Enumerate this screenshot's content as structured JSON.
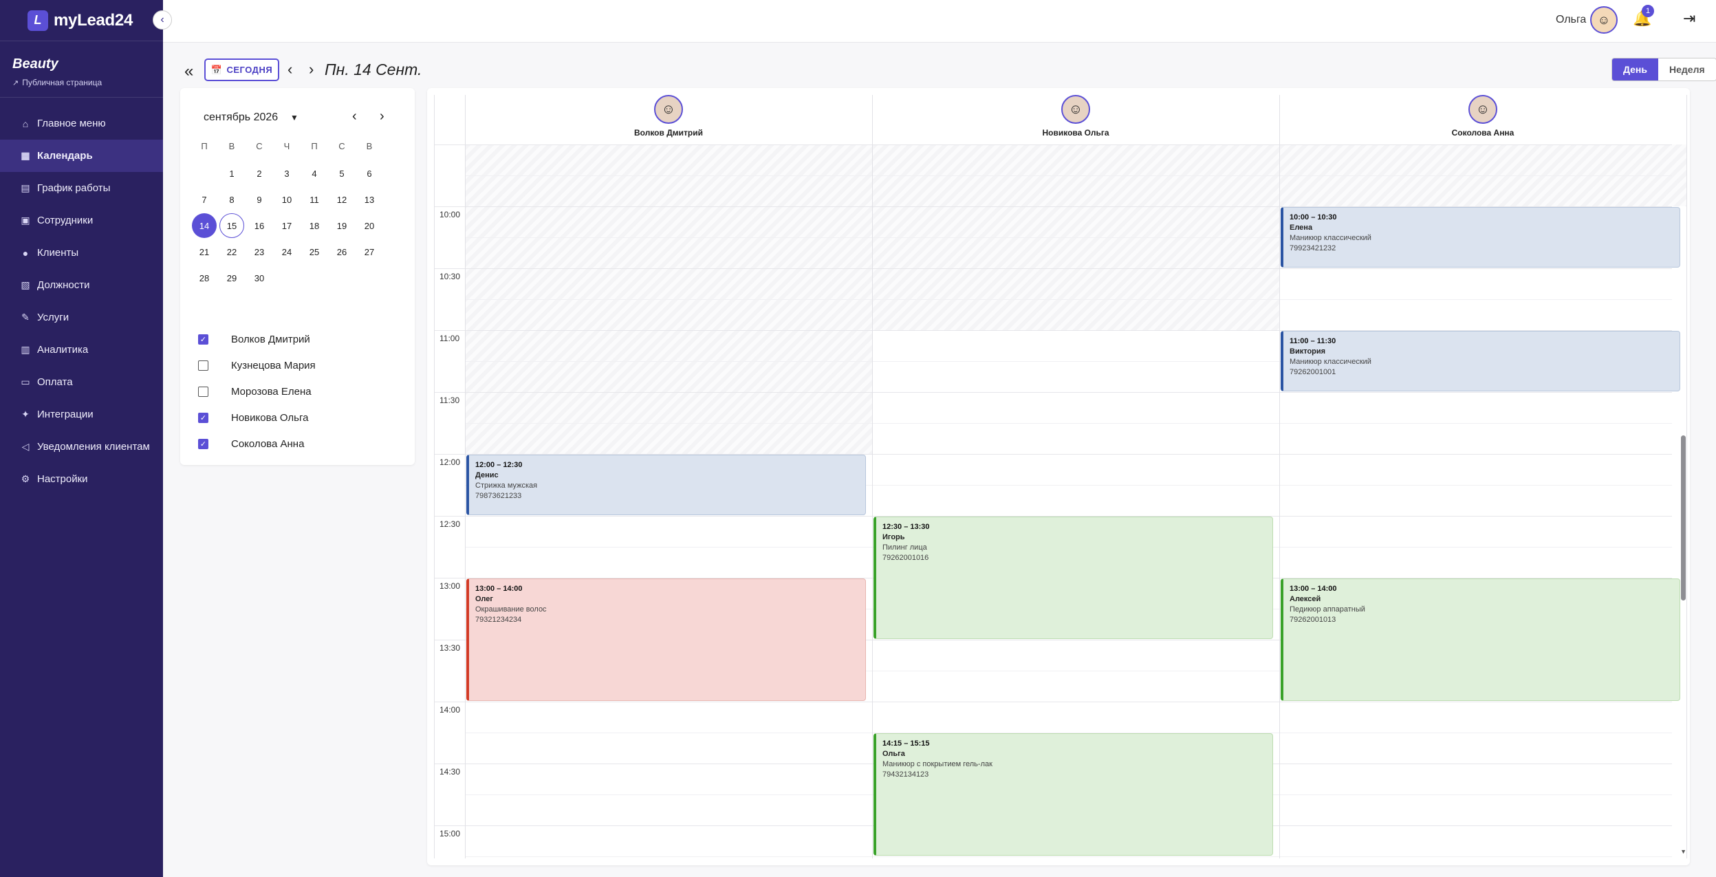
{
  "brand": {
    "logo_letter": "L",
    "name": "myLead24"
  },
  "organization": {
    "name": "Beauty",
    "public_page_label": "Публичная страница"
  },
  "menu": [
    {
      "label": "Главное меню",
      "icon": "home"
    },
    {
      "label": "Календарь",
      "icon": "calendar",
      "active": true
    },
    {
      "label": "График работы",
      "icon": "schedule"
    },
    {
      "label": "Сотрудники",
      "icon": "users"
    },
    {
      "label": "Клиенты",
      "icon": "user"
    },
    {
      "label": "Должности",
      "icon": "briefcase"
    },
    {
      "label": "Услуги",
      "icon": "brush"
    },
    {
      "label": "Аналитика",
      "icon": "chart"
    },
    {
      "label": "Оплата",
      "icon": "card"
    },
    {
      "label": "Интеграции",
      "icon": "puzzle"
    },
    {
      "label": "Уведомления клиентам",
      "icon": "megaphone"
    },
    {
      "label": "Настройки",
      "icon": "gear"
    }
  ],
  "topbar": {
    "user_name": "Ольга",
    "notifications_count": "1"
  },
  "toolbar": {
    "today_label": "СЕГОДНЯ",
    "date_title": "Пн. 14 Сент.",
    "view_day": "День",
    "view_week": "Неделя"
  },
  "mini_calendar": {
    "month_label": "сентябрь 2026",
    "weekdays": [
      "П",
      "В",
      "С",
      "Ч",
      "П",
      "С",
      "В"
    ],
    "weeks": [
      [
        "",
        "1",
        "2",
        "3",
        "4",
        "5",
        "6"
      ],
      [
        "7",
        "8",
        "9",
        "10",
        "11",
        "12",
        "13"
      ],
      [
        "14",
        "15",
        "16",
        "17",
        "18",
        "19",
        "20"
      ],
      [
        "21",
        "22",
        "23",
        "24",
        "25",
        "26",
        "27"
      ],
      [
        "28",
        "29",
        "30",
        "",
        "",
        "",
        ""
      ]
    ],
    "selected": "14",
    "today": "15"
  },
  "staff_filter": [
    {
      "name": "Волков Дмитрий",
      "checked": true
    },
    {
      "name": "Кузнецова Мария",
      "checked": false
    },
    {
      "name": "Морозова Елена",
      "checked": false
    },
    {
      "name": "Новикова Ольга",
      "checked": true
    },
    {
      "name": "Соколова Анна",
      "checked": true
    }
  ],
  "columns": [
    {
      "name": "Волков Дмитрий",
      "avatar_icon": "male-avatar"
    },
    {
      "name": "Новикова Ольга",
      "avatar_icon": "female-avatar"
    },
    {
      "name": "Соколова Анна",
      "avatar_icon": "female-avatar"
    }
  ],
  "time_slots": [
    "10:00",
    "10:30",
    "11:00",
    "11:30",
    "12:00",
    "12:30",
    "13:00",
    "13:30",
    "14:00",
    "14:30",
    "15:00"
  ],
  "events": [
    {
      "column": 2,
      "time": "10:00 – 10:30",
      "client": "Елена",
      "service": "Маникюр классический",
      "phone": "79923421232",
      "color": "blue",
      "start": "10:00",
      "end": "10:30"
    },
    {
      "column": 2,
      "time": "11:00 – 11:30",
      "client": "Виктория",
      "service": "Маникюр классический",
      "phone": "79262001001",
      "color": "blue",
      "start": "11:00",
      "end": "11:30"
    },
    {
      "column": 0,
      "time": "12:00 – 12:30",
      "client": "Денис",
      "service": "Стрижка мужская",
      "phone": "79873621233",
      "color": "blue",
      "start": "12:00",
      "end": "12:30"
    },
    {
      "column": 1,
      "time": "12:30 – 13:30",
      "client": "Игорь",
      "service": "Пилинг лица",
      "phone": "79262001016",
      "color": "green",
      "start": "12:30",
      "end": "13:30"
    },
    {
      "column": 0,
      "time": "13:00 – 14:00",
      "client": "Олег",
      "service": "Окрашивание волос",
      "phone": "79321234234",
      "color": "red",
      "start": "13:00",
      "end": "14:00"
    },
    {
      "column": 2,
      "time": "13:00 – 14:00",
      "client": "Алексей",
      "service": "Педикюр аппаратный",
      "phone": "79262001013",
      "color": "green",
      "start": "13:00",
      "end": "14:00"
    },
    {
      "column": 1,
      "time": "14:15 – 15:15",
      "client": "Ольга",
      "service": "Маникюр с покрытием гель-лак",
      "phone": "79432134123",
      "color": "green",
      "start": "14:15",
      "end": "15:15"
    }
  ],
  "colors": {
    "accent": "#5b4fd6",
    "sidebar": "#2a2160",
    "event_blue": "#dbe3ef",
    "event_green": "#dff0da",
    "event_red": "#f7d7d5"
  }
}
